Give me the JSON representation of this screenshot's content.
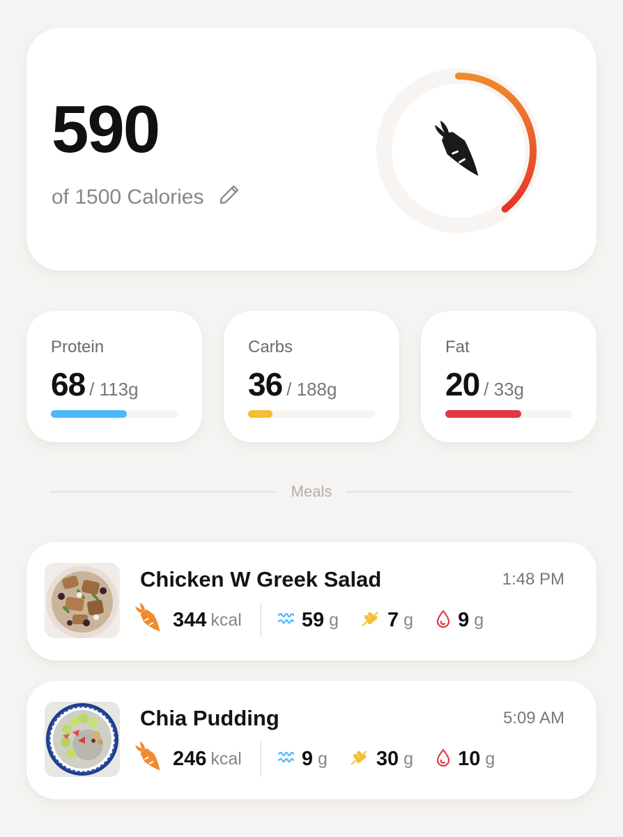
{
  "calories": {
    "consumed": "590",
    "subtitle": "of 1500 Calories",
    "progress": 0.393,
    "ring_color_start": "#f08a2c",
    "ring_color_end": "#e5322b",
    "icons": [
      "pencil-icon",
      "carrot-icon"
    ]
  },
  "macros": [
    {
      "label": "Protein",
      "value": "68",
      "total": "/ 113g",
      "progress": 0.6,
      "color": "#4db8fc"
    },
    {
      "label": "Carbs",
      "value": "36",
      "total": "/ 188g",
      "progress": 0.19,
      "color": "#f5be36"
    },
    {
      "label": "Fat",
      "value": "20",
      "total": "/ 33g",
      "progress": 0.6,
      "color": "#e23845"
    }
  ],
  "meals_label": "Meals",
  "meals": [
    {
      "name": "Chicken W Greek Salad",
      "time": "1:48 PM",
      "kcal": "344",
      "kcal_unit": "kcal",
      "protein": "59",
      "carbs": "7",
      "fat": "9",
      "unit": "g",
      "thumbnail": "chicken-salad-photo"
    },
    {
      "name": "Chia Pudding",
      "time": "5:09 AM",
      "kcal": "246",
      "kcal_unit": "kcal",
      "protein": "9",
      "carbs": "30",
      "fat": "10",
      "unit": "g",
      "thumbnail": "chia-pudding-photo"
    }
  ],
  "colors": {
    "background": "#f6f4f2",
    "protein": "#4db8fc",
    "carbs": "#f5be36",
    "fat": "#e23845",
    "carrot": "#f28a2e"
  }
}
